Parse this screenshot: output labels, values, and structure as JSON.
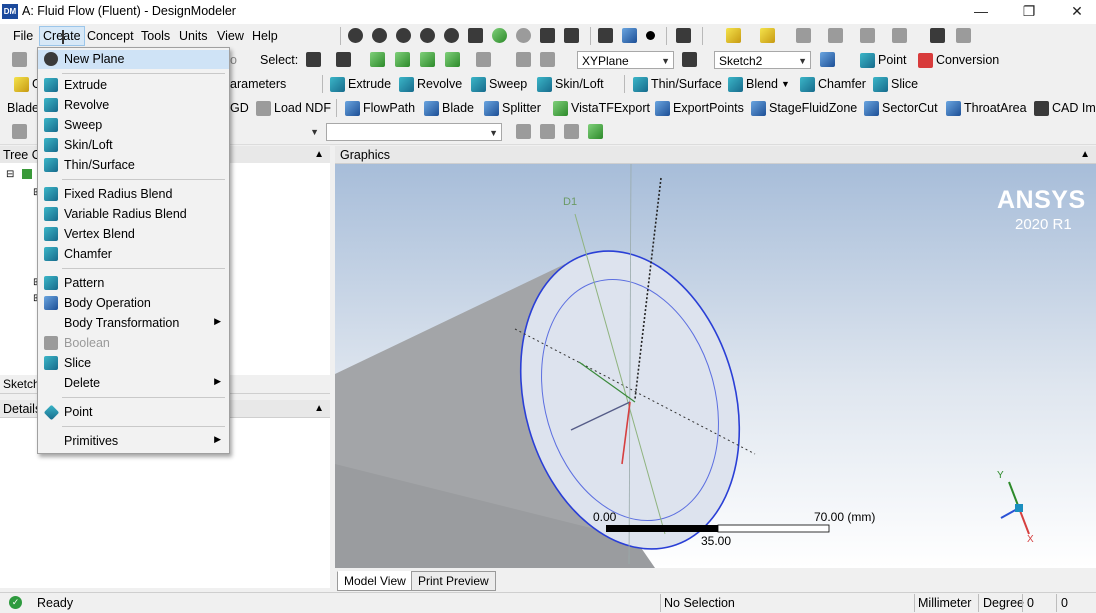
{
  "window": {
    "app_icon": "DM",
    "title": "A: Fluid Flow (Fluent) - DesignModeler"
  },
  "menubar": {
    "items": [
      "File",
      "Create",
      "Concept",
      "Tools",
      "Units",
      "View",
      "Help"
    ],
    "active": "Create"
  },
  "toolbar1": {
    "select_label": "Select:",
    "plane_value": "XYPlane",
    "sketch_value": "Sketch2",
    "point_label": "Point",
    "conversion_label": "Conversion",
    "partial_undo": "o"
  },
  "toolbar2": {
    "partial_left": "G",
    "parameters_label": "arameters",
    "extrude_label": "Extrude",
    "revolve_label": "Revolve",
    "sweep_label": "Sweep",
    "skinloft_label": "Skin/Loft",
    "thinsurface_label": "Thin/Surface",
    "blend_label": "Blend",
    "chamfer_label": "Chamfer",
    "slice_label": "Slice"
  },
  "toolbar3": {
    "blade_partial": "Blade",
    "gd_partial": "GD",
    "load_ndf_label": "Load NDF",
    "flowpath_label": "FlowPath",
    "blade_label": "Blade",
    "splitter_label": "Splitter",
    "vistatf_label": "VistaTFExport",
    "exportpoints_label": "ExportPoints",
    "stagefluidzone_label": "StageFluidZone",
    "sectorcut_label": "SectorCut",
    "throatarea_label": "ThroatArea",
    "cadimp_label": "CAD Imp"
  },
  "panels": {
    "tree_title": "Tree O",
    "sketch_tab": "Sketch",
    "details_title": "Details",
    "graphics_title": "Graphics"
  },
  "dropdown": {
    "items": [
      {
        "label": "New Plane",
        "icon": "new-plane-icon",
        "submenu": false,
        "disabled": false
      },
      {
        "label": "Extrude",
        "icon": "extrude-icon",
        "submenu": false,
        "disabled": false
      },
      {
        "label": "Revolve",
        "icon": "revolve-icon",
        "submenu": false,
        "disabled": false
      },
      {
        "label": "Sweep",
        "icon": "sweep-icon",
        "submenu": false,
        "disabled": false
      },
      {
        "label": "Skin/Loft",
        "icon": "skin-loft-icon",
        "submenu": false,
        "disabled": false
      },
      {
        "label": "Thin/Surface",
        "icon": "thin-surface-icon",
        "submenu": false,
        "disabled": false
      },
      {
        "label": "Fixed Radius Blend",
        "icon": "fixed-radius-blend-icon",
        "submenu": false,
        "disabled": false
      },
      {
        "label": "Variable Radius Blend",
        "icon": "variable-radius-blend-icon",
        "submenu": false,
        "disabled": false
      },
      {
        "label": "Vertex Blend",
        "icon": "vertex-blend-icon",
        "submenu": false,
        "disabled": false
      },
      {
        "label": "Chamfer",
        "icon": "chamfer-icon",
        "submenu": false,
        "disabled": false
      },
      {
        "label": "Pattern",
        "icon": "pattern-icon",
        "submenu": false,
        "disabled": false
      },
      {
        "label": "Body Operation",
        "icon": "body-operation-icon",
        "submenu": false,
        "disabled": false
      },
      {
        "label": "Body Transformation",
        "icon": "",
        "submenu": true,
        "disabled": false
      },
      {
        "label": "Boolean",
        "icon": "boolean-icon",
        "submenu": false,
        "disabled": true
      },
      {
        "label": "Slice",
        "icon": "slice-icon",
        "submenu": false,
        "disabled": false
      },
      {
        "label": "Delete",
        "icon": "",
        "submenu": true,
        "disabled": false
      },
      {
        "label": "Point",
        "icon": "point-icon",
        "submenu": false,
        "disabled": false
      },
      {
        "label": "Primitives",
        "icon": "",
        "submenu": true,
        "disabled": false
      }
    ]
  },
  "graphics": {
    "brand": "ANSYS",
    "version": "2020 R1",
    "axis_label_d1": "D1",
    "scale_start": "0.00",
    "scale_mid": "35.00",
    "scale_end": "70.00 (mm)",
    "triad_y": "Y",
    "triad_x": "X"
  },
  "tabs": {
    "model_view": "Model View",
    "print_preview": "Print Preview"
  },
  "status": {
    "text": "Ready",
    "selection": "No Selection",
    "length_unit": "Millimeter",
    "angle_unit": "Degree",
    "value1": "0",
    "value2": "0"
  },
  "colors": {
    "menu_highlight": "#cfe3f6",
    "viewport_top": "#a7bdd9",
    "model_gray": "#9fa1a3",
    "edge_blue": "#2a3fd6"
  }
}
